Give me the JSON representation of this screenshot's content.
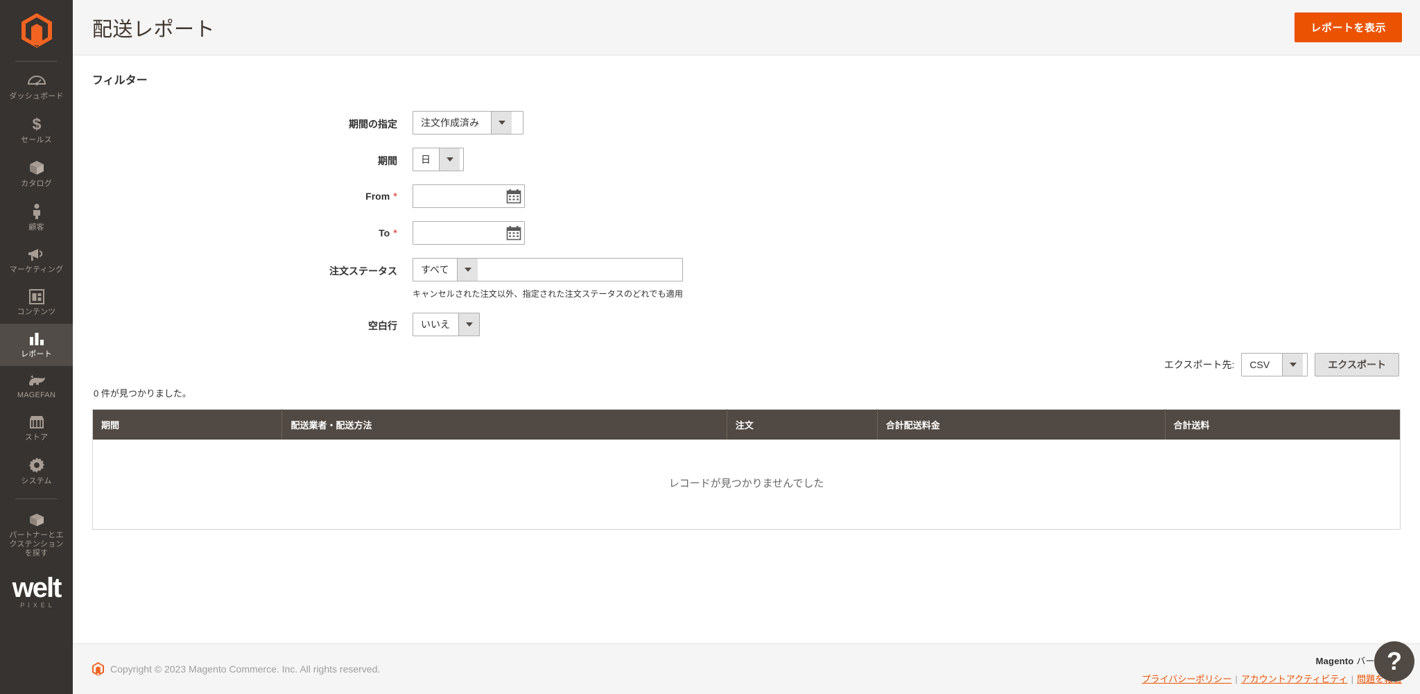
{
  "sidebar": {
    "logo_name": "magento-logo",
    "items": [
      {
        "label": "ダッシュボード",
        "icon": "dashboard-icon",
        "active": false
      },
      {
        "label": "セールス",
        "icon": "sales-dollar-icon",
        "active": false
      },
      {
        "label": "カタログ",
        "icon": "catalog-box-icon",
        "active": false
      },
      {
        "label": "顧客",
        "icon": "customers-person-icon",
        "active": false
      },
      {
        "label": "マーケティング",
        "icon": "marketing-megaphone-icon",
        "active": false
      },
      {
        "label": "コンテンツ",
        "icon": "content-window-icon",
        "active": false
      },
      {
        "label": "レポート",
        "icon": "reports-bars-icon",
        "active": true
      },
      {
        "label": "MAGEFAN",
        "icon": "magefan-icon",
        "active": false
      },
      {
        "label": "ストア",
        "icon": "stores-shop-icon",
        "active": false
      },
      {
        "label": "システム",
        "icon": "system-gear-icon",
        "active": false
      },
      {
        "label": "パートナーとエ\nクステンション\nを探す",
        "icon": "partners-box-icon",
        "active": false
      }
    ],
    "brand_logo_main": "welt",
    "brand_logo_sub": "PIXEL"
  },
  "header": {
    "title": "配送レポート",
    "primary_button": "レポートを表示"
  },
  "filters": {
    "section_title": "フィルター",
    "period_spec": {
      "label": "期間の指定",
      "value": "注文作成済み"
    },
    "period": {
      "label": "期間",
      "value": "日"
    },
    "from": {
      "label": "From",
      "required": "*",
      "value": "",
      "placeholder": ""
    },
    "to": {
      "label": "To",
      "required": "*",
      "value": "",
      "placeholder": ""
    },
    "order_status": {
      "label": "注文ステータス",
      "value": "すべて",
      "note": "キャンセルされた注文以外、指定された注文ステータスのどれでも適用"
    },
    "empty_rows": {
      "label": "空白行",
      "value": "いいえ"
    }
  },
  "export": {
    "label": "エクスポート先:",
    "format": "CSV",
    "button": "エクスポート"
  },
  "grid": {
    "records_found": "0 件が見つかりました。",
    "columns": [
      "期間",
      "配送業者・配送方法",
      "注文",
      "合計配送料金",
      "合計送料"
    ],
    "empty_message": "レコードが見つかりませんでした",
    "rows": []
  },
  "footer": {
    "copyright": "Copyright © 2023 Magento Commerce. Inc. All rights reserved.",
    "version_prefix": "Magento",
    "version_label": "バージョン",
    "links": [
      "プライバシーポリシー",
      "アカウントアクティビティ",
      "問題を報告"
    ],
    "separator": "|",
    "help_glyph": "?"
  },
  "colors": {
    "accent": "#eb5202",
    "sidebar_bg": "#373330",
    "table_header_bg": "#514943",
    "page_header_bg": "#f5f5f5"
  }
}
